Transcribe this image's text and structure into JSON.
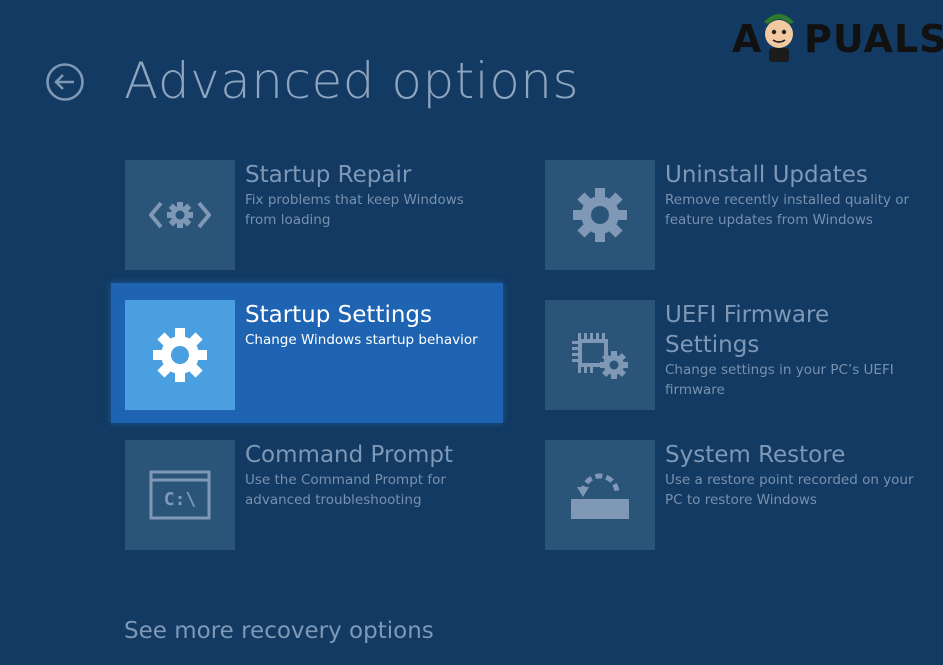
{
  "page": {
    "title": "Advanced options",
    "more_link": "See more recovery options"
  },
  "watermark": {
    "text": "APPUALS",
    "left_part": "A",
    "right_part": "PUALS"
  },
  "options": [
    {
      "id": "startup-repair",
      "title": "Startup Repair",
      "description": "Fix problems that keep Windows from loading",
      "icon": "startup-repair-icon",
      "selected": false
    },
    {
      "id": "uninstall-updates",
      "title": "Uninstall Updates",
      "description": "Remove recently installed quality or feature updates from Windows",
      "icon": "gear-icon",
      "selected": false
    },
    {
      "id": "startup-settings",
      "title": "Startup Settings",
      "description": "Change Windows startup behavior",
      "icon": "gear-icon",
      "selected": true
    },
    {
      "id": "uefi-firmware-settings",
      "title": "UEFI Firmware Settings",
      "title_line1": "UEFI Firmware",
      "title_line2": "Settings",
      "description": "Change settings in your PC’s UEFI firmware",
      "icon": "firmware-chip-icon",
      "selected": false
    },
    {
      "id": "command-prompt",
      "title": "Command Prompt",
      "description": "Use the Command Prompt for advanced troubleshooting",
      "icon": "command-prompt-icon",
      "icon_text": "C:\\",
      "selected": false
    },
    {
      "id": "system-restore",
      "title": "System Restore",
      "description": "Use a restore point recorded on your PC to restore Windows",
      "icon": "system-restore-icon",
      "selected": false
    }
  ],
  "colors": {
    "background": "#123a62",
    "tile": "#2b5479",
    "text": "#7e98b6",
    "highlight": "#1f63b3",
    "selected_tile": "#4a9fe0"
  }
}
